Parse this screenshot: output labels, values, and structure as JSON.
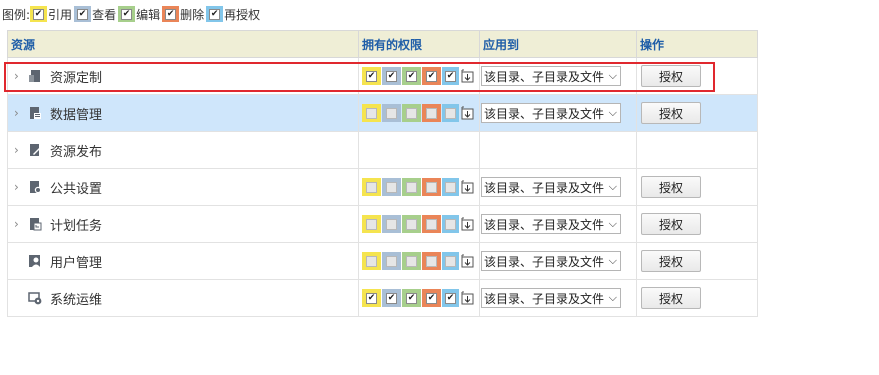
{
  "legend": {
    "label": "图例:",
    "items": [
      {
        "label": "引用",
        "color": "#f5e44f"
      },
      {
        "label": "查看",
        "color": "#a9bfd6"
      },
      {
        "label": "编辑",
        "color": "#a7cf8c"
      },
      {
        "label": "删除",
        "color": "#ea8558"
      },
      {
        "label": "再授权",
        "color": "#82c6ea"
      }
    ]
  },
  "table": {
    "headers": {
      "resource": "资源",
      "permissions": "拥有的权限",
      "apply_to": "应用到",
      "action": "操作"
    },
    "rows": [
      {
        "name": "资源定制",
        "icon": "resource-custom-icon",
        "expandable": true,
        "selected": false,
        "checks": [
          true,
          true,
          true,
          true,
          true
        ],
        "disabled": false,
        "apply": "该目录、子目录及文件",
        "action": "授权",
        "has_perms": true,
        "highlighted": true
      },
      {
        "name": "数据管理",
        "icon": "data-management-icon",
        "expandable": true,
        "selected": true,
        "checks": [
          false,
          false,
          false,
          false,
          false
        ],
        "disabled": true,
        "apply": "该目录、子目录及文件",
        "action": "授权",
        "has_perms": true,
        "highlighted": false
      },
      {
        "name": "资源发布",
        "icon": "resource-publish-icon",
        "expandable": true,
        "selected": false,
        "checks": [],
        "disabled": false,
        "apply": "",
        "action": "",
        "has_perms": false,
        "highlighted": false
      },
      {
        "name": "公共设置",
        "icon": "public-settings-icon",
        "expandable": true,
        "selected": false,
        "checks": [
          false,
          false,
          false,
          false,
          false
        ],
        "disabled": true,
        "apply": "该目录、子目录及文件",
        "action": "授权",
        "has_perms": true,
        "highlighted": false
      },
      {
        "name": "计划任务",
        "icon": "scheduled-task-icon",
        "expandable": true,
        "selected": false,
        "checks": [
          false,
          false,
          false,
          false,
          false
        ],
        "disabled": true,
        "apply": "该目录、子目录及文件",
        "action": "授权",
        "has_perms": true,
        "highlighted": false
      },
      {
        "name": "用户管理",
        "icon": "user-management-icon",
        "expandable": false,
        "selected": false,
        "checks": [
          false,
          false,
          false,
          false,
          false
        ],
        "disabled": true,
        "apply": "该目录、子目录及文件",
        "action": "授权",
        "has_perms": true,
        "highlighted": false
      },
      {
        "name": "系统运维",
        "icon": "system-ops-icon",
        "expandable": false,
        "selected": false,
        "checks": [
          true,
          true,
          true,
          true,
          true
        ],
        "disabled": false,
        "apply": "该目录、子目录及文件",
        "action": "授权",
        "has_perms": true,
        "highlighted": false
      }
    ]
  },
  "check_glyph": "✔",
  "chevron_right": "›",
  "chevron_down": "⌵"
}
